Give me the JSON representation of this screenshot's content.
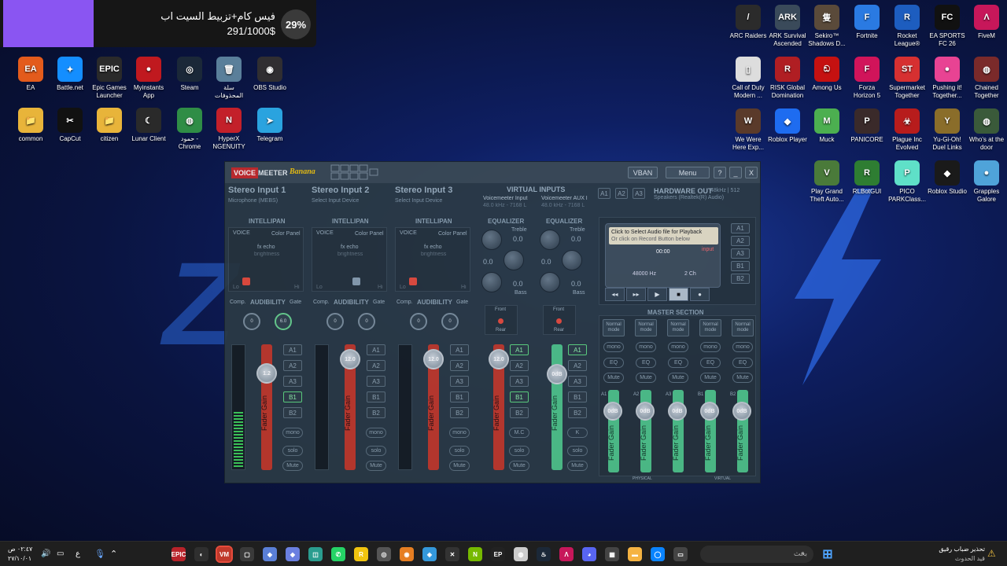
{
  "notification": {
    "title": "فيس كام+تزبيط السيت اب",
    "amount": "291/1000$",
    "percent": "29%"
  },
  "desktop_left": [
    {
      "label": "EA",
      "glyph": "EA",
      "color": "#e35b1c"
    },
    {
      "label": "Battle.net",
      "glyph": "✦",
      "color": "#148eff"
    },
    {
      "label": "Epic Games Launcher",
      "glyph": "EPIC",
      "color": "#2a2a2a"
    },
    {
      "label": "Myinstants App",
      "glyph": "●",
      "color": "#c0191f"
    },
    {
      "label": "Steam",
      "glyph": "◎",
      "color": "#1b2838"
    },
    {
      "label": "سلة المحذوفات",
      "glyph": "🗑",
      "color": "#5a7f9a"
    },
    {
      "label": "OBS Studio",
      "glyph": "◉",
      "color": "#302e31"
    },
    {
      "label": "common",
      "glyph": "📁",
      "color": "#e8b43a"
    },
    {
      "label": "CapCut",
      "glyph": "✂",
      "color": "#111111"
    },
    {
      "label": "citizen",
      "glyph": "📁",
      "color": "#e8b43a"
    },
    {
      "label": "Lunar Client",
      "glyph": "☾",
      "color": "#2a2a2a"
    },
    {
      "label": "حمود - Chrome",
      "glyph": "◍",
      "color": "#2f8d46"
    },
    {
      "label": "HyperX NGENUITY",
      "glyph": "N",
      "color": "#c3202a"
    },
    {
      "label": "Telegram",
      "glyph": "➤",
      "color": "#2aa3df"
    }
  ],
  "desktop_right": [
    {
      "label": "ARC Raiders",
      "glyph": "/",
      "color": "#2b2b2b"
    },
    {
      "label": "ARK Survival Ascended",
      "glyph": "ARK",
      "color": "#3a4a5a"
    },
    {
      "label": "Sekiro™ Shadows D...",
      "glyph": "隻",
      "color": "#5a4a3a"
    },
    {
      "label": "Fortnite",
      "glyph": "F",
      "color": "#2a7ae2"
    },
    {
      "label": "Rocket League®",
      "glyph": "R",
      "color": "#1d5dbf"
    },
    {
      "label": "EA SPORTS FC 26",
      "glyph": "FC",
      "color": "#111111"
    },
    {
      "label": "FiveM",
      "glyph": "Λ",
      "color": "#c7175a"
    },
    {
      "label": "Call of Duty Modern ...",
      "glyph": "▯",
      "color": "#dddddd"
    },
    {
      "label": "RISK Global Domination",
      "glyph": "R",
      "color": "#b01e23"
    },
    {
      "label": "Among Us",
      "glyph": "ඞ",
      "color": "#c51111"
    },
    {
      "label": "Forza Horizon 5",
      "glyph": "F",
      "color": "#d1145a"
    },
    {
      "label": "Supermarket Together",
      "glyph": "ST",
      "color": "#d63031"
    },
    {
      "label": "Pushing it! Together...",
      "glyph": "●",
      "color": "#e84393"
    },
    {
      "label": "Chained Together",
      "glyph": "◍",
      "color": "#7a2a2a"
    },
    {
      "label": "We Were Here Exp...",
      "glyph": "W",
      "color": "#5a3a2a"
    },
    {
      "label": "Roblox Player",
      "glyph": "◆",
      "color": "#1e6cf0"
    },
    {
      "label": "Muck",
      "glyph": "M",
      "color": "#4caf50"
    },
    {
      "label": "PANICORE",
      "glyph": "P",
      "color": "#3a2a2a"
    },
    {
      "label": "Plague Inc Evolved",
      "glyph": "☣",
      "color": "#b71c1c"
    },
    {
      "label": "Yu-Gi-Oh! Duel Links",
      "glyph": "Y",
      "color": "#8a6d2a"
    },
    {
      "label": "Who's at the door",
      "glyph": "◍",
      "color": "#3a5a3a"
    },
    {
      "label": "Play Grand Theft Auto...",
      "glyph": "V",
      "color": "#4a7a3a"
    },
    {
      "label": "RLBotGUI",
      "glyph": "R",
      "color": "#2e7d32"
    },
    {
      "label": "PICO PARKClass...",
      "glyph": "P",
      "color": "#5fe0c8"
    },
    {
      "label": "Roblox Studio",
      "glyph": "◆",
      "color": "#1a1a1a"
    },
    {
      "label": "Grapples Galore",
      "glyph": "●",
      "color": "#4fa3d9"
    }
  ],
  "voicemeeter": {
    "logo_voice": "VOICE",
    "logo_meeter": "MEETER",
    "logo_banana": "Banana",
    "logo_rs": "R R R R\nR R R R",
    "vban_label": "VBAN",
    "menu_label": "Menu",
    "help_label": "?",
    "min_label": "_",
    "close_label": "X",
    "inputs": [
      {
        "title": "Stereo Input 1",
        "sub": "Microphone (MEBS)",
        "gain": "1.2",
        "comp": "0",
        "gate": "6.0",
        "meter": 0.45
      },
      {
        "title": "Stereo Input 2",
        "sub": "Select Input Device",
        "gain": "12.0",
        "comp": "0",
        "gate": "0",
        "meter": 0
      },
      {
        "title": "Stereo Input 3",
        "sub": "Select Input Device",
        "gain": "12.0",
        "comp": "0",
        "gate": "0",
        "meter": 0
      }
    ],
    "intellipan": "INTELLIPAN",
    "voice": "VOICE",
    "color_panel": "Color Panel",
    "fx_echo": "fx echo",
    "brightness": "brightness",
    "lo": "Lo",
    "hi": "Hi",
    "comp_label": "Comp.",
    "audibility": "AUDIBILITY",
    "gate_label": "Gate",
    "fader_gain": "Fader Gain",
    "virtual_inputs": "VIRTUAL INPUTS",
    "virtual": [
      {
        "title": "Voicemeeter Input",
        "sub": "48.0 kHz - 7168 L",
        "gain": "12.0",
        "last": "M.C"
      },
      {
        "title": "Voicemeeter AUX I",
        "sub": "48.0 kHz - 7168 L",
        "gain": "0dB",
        "last": "K"
      }
    ],
    "equalizer": "EQUALIZER",
    "treble": "Treble",
    "bass": "Bass",
    "eq_val": "0.0",
    "front": "Front",
    "rear": "Rear",
    "bus_labels": [
      "A1",
      "A2",
      "A3",
      "B1",
      "B2"
    ],
    "mono": "mono",
    "solo": "solo",
    "mute": "Mute",
    "hw_out_tabs": [
      "A1",
      "A2",
      "A3"
    ],
    "hardware_out": "HARDWARE OUT",
    "hw_rate": "48kHz | 512",
    "hw_device": "Speakers (Realtek(R) Audio)",
    "cassette_msg1": "Click to Select Audio file for Playback",
    "cassette_msg2": "Or click on Record Button below",
    "cassette_time": "00:00",
    "cassette_input": "input",
    "cassette_rate": "48000 Hz",
    "cassette_ch": "2 Ch",
    "transport": [
      "◂◂",
      "▸▸",
      "▶",
      "■",
      "●"
    ],
    "master_section": "MASTER SECTION",
    "normal_mode": "Normal mode",
    "eq_btn": "EQ",
    "master_gain": "0dB",
    "master_labels": [
      "A1",
      "A2",
      "A3",
      "B1",
      "B2"
    ],
    "physical": "PHYSICAL",
    "virtual_lbl": "VIRTUAL"
  },
  "taskbar": {
    "time": "٠٢:٤٧ ص",
    "date": "٢٧/١٠/٠١",
    "lang": "ع",
    "search_placeholder": "بحث",
    "weather_title": "تحذير ضباب رقيق",
    "weather_sub": "قيد الحدوث"
  }
}
